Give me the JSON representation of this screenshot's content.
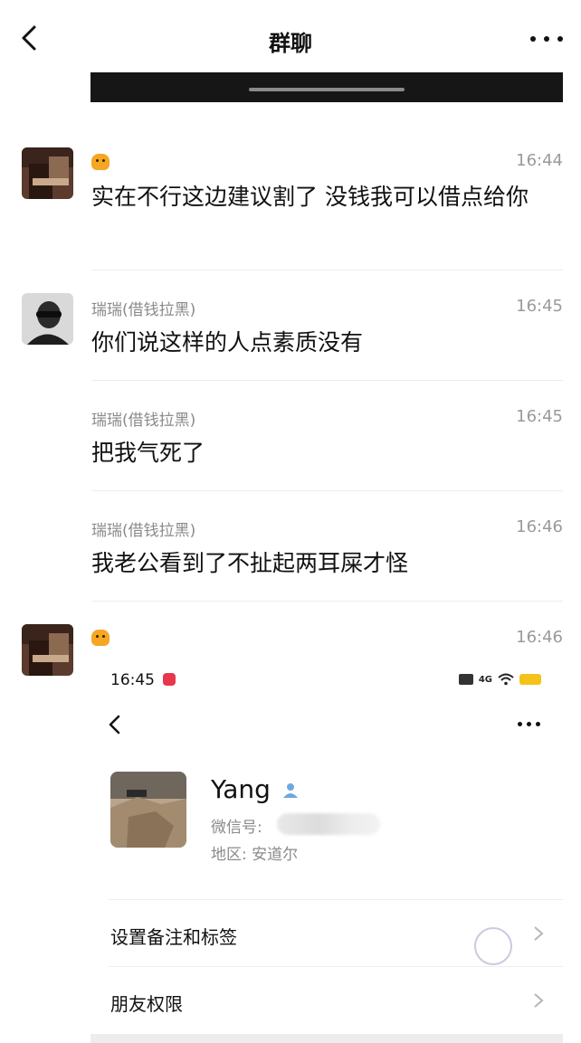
{
  "header": {
    "title": "群聊"
  },
  "messages": [
    {
      "sender": "",
      "time": "16:44",
      "text": "实在不行这边建议割了  没钱我可以借点给你"
    },
    {
      "sender": "瑞瑞(借钱拉黑)",
      "time": "16:45",
      "text": "你们说这样的人点素质没有"
    },
    {
      "sender": "瑞瑞(借钱拉黑)",
      "time": "16:45",
      "text": "把我气死了"
    },
    {
      "sender": "瑞瑞(借钱拉黑)",
      "time": "16:46",
      "text": "我老公看到了不扯起两耳屎才怪"
    },
    {
      "sender": "",
      "time": "16:46",
      "text": ""
    }
  ],
  "embedded_screenshot": {
    "status_time": "16:45",
    "network_label": "4G",
    "profile": {
      "name": "Yang",
      "wechat_id_label": "微信号:",
      "region": "地区: 安道尔"
    },
    "settings": [
      {
        "label": "设置备注和标签"
      },
      {
        "label": "朋友权限"
      }
    ]
  },
  "colors": {
    "battery": "#f4c21a",
    "sender_gray": "#8a8a8a",
    "tiger_emoji": "#f5a623"
  }
}
